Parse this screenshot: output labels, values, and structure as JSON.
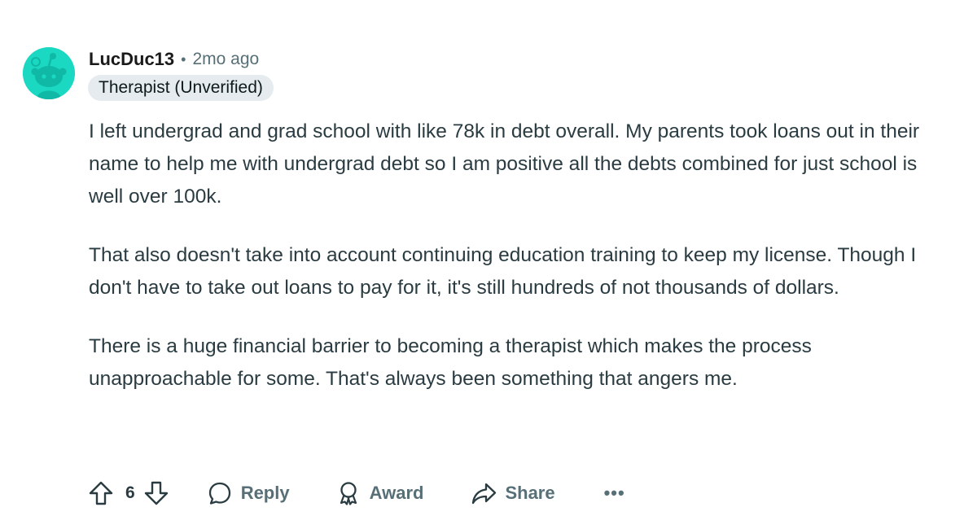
{
  "comment": {
    "username": "LucDuc13",
    "separator": "•",
    "time": "2mo ago",
    "flair": "Therapist (Unverified)",
    "paragraphs": [
      "I left undergrad and grad school with like 78k in debt overall. My parents took loans out in their name to help me with undergrad debt so I am positive all the debts combined for just school is well over 100k.",
      "That also doesn't take into account continuing education training to keep my license. Though I don't have to take out loans to pay for it, it's still hundreds of not thousands of dollars.",
      "There is a huge financial barrier to becoming a therapist which makes the process unapproachable for some. That's always been something that angers me."
    ]
  },
  "actions": {
    "vote_count": "6",
    "reply_label": "Reply",
    "award_label": "Award",
    "share_label": "Share",
    "more_label": "•••"
  },
  "icons": {
    "avatar": "snoo-avatar-icon",
    "upvote": "upvote-arrow-icon",
    "downvote": "downvote-arrow-icon",
    "reply": "speech-bubble-icon",
    "award": "award-ribbon-icon",
    "share": "share-arrow-icon",
    "more": "ellipsis-icon"
  },
  "colors": {
    "avatar_bg": "#1ad8c2",
    "flair_bg": "#e5ebee",
    "meta_text": "#576f76",
    "body_text": "#2a3c42"
  }
}
